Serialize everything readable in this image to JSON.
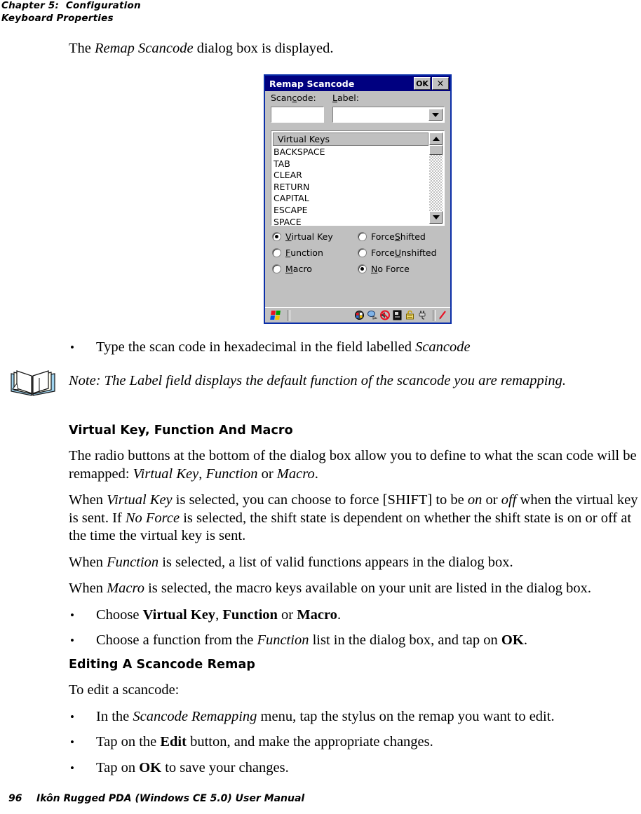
{
  "header": {
    "chapter": "Chapter 5:  Configuration",
    "section": "Keyboard Properties"
  },
  "intro": {
    "line_before": "The ",
    "emphasis": "Remap Scancode",
    "line_after": " dialog box is displayed."
  },
  "dialog": {
    "title": "Remap Scancode",
    "ok_label": "OK",
    "close_label": "×",
    "scancode_label": {
      "pre": "Scan",
      "accel": "c",
      "post": "ode:"
    },
    "label_label": {
      "pre": "",
      "accel": "L",
      "post": "abel:"
    },
    "scancode_value": "",
    "label_value": "",
    "list_header": "Virtual Keys",
    "list_items": [
      "BACKSPACE",
      "TAB",
      "CLEAR",
      "RETURN",
      "CAPITAL",
      "ESCAPE",
      "SPACE"
    ],
    "radios_left": [
      {
        "pre": "",
        "accel": "V",
        "post": "irtual Key",
        "selected": true
      },
      {
        "pre": "",
        "accel": "F",
        "post": "unction",
        "selected": false
      },
      {
        "pre": "",
        "accel": "M",
        "post": "acro",
        "selected": false
      }
    ],
    "radios_right": [
      {
        "pre": "Force ",
        "accel": "S",
        "post": "hifted",
        "selected": false
      },
      {
        "pre": "Force ",
        "accel": "U",
        "post": "nshifted",
        "selected": false
      },
      {
        "pre": "",
        "accel": "N",
        "post": "o Force",
        "selected": true
      }
    ],
    "titlebar_color": "#000080",
    "face_color": "#c0c0c0",
    "border_color": "#0a2ea8",
    "taskbar": {
      "start_icon": "windows-flag-icon",
      "tray_icons": [
        "network-icon",
        "desktop-icon",
        "no-sound-icon",
        "battery-icon",
        "unlock-icon",
        "power-plug-icon",
        "stylus-icon"
      ]
    }
  },
  "bullet_type_scan": {
    "pre": "Type the scan code in hexadecimal in the field labelled ",
    "em": "Scancode",
    "post": ""
  },
  "note": {
    "icon": "open-book-icon",
    "text": "Note: The Label field displays the default function of the scancode you are remapping."
  },
  "section_vkfm": {
    "heading": "Virtual Key, Function And Macro",
    "para1": {
      "a": "The radio buttons at the bottom of the dialog box allow you to define to what the scan code will be remapped: ",
      "em1": "Virtual Key",
      "b": ", ",
      "em2": "Function",
      "c": " or ",
      "em3": "Macro",
      "d": "."
    },
    "para2": {
      "a": "When ",
      "em1": "Virtual Key",
      "b": " is selected, you can choose to force [SHIFT] to be ",
      "em2": "on",
      "c": " or ",
      "em3": "off",
      "d": " when the virtual key is sent. If ",
      "em4": "No Force",
      "e": " is selected, the shift state is dependent on whether the shift state is on or off at the time the virtual key is sent."
    },
    "para3": {
      "a": "When ",
      "em1": "Function",
      "b": " is selected, a list of valid functions appears in the dialog box."
    },
    "para4": {
      "a": "When ",
      "em1": "Macro",
      "b": " is selected, the macro keys available on your unit are listed in the dialog box."
    },
    "bullet1": {
      "a": "Choose ",
      "b1": "Virtual Key",
      "c": ", ",
      "b2": "Function",
      "d": " or ",
      "b3": "Macro",
      "e": "."
    },
    "bullet2": {
      "a": "Choose a function from the ",
      "em": "Function",
      "b": " list in the dialog box, and tap on ",
      "bd": "OK",
      "c": "."
    }
  },
  "section_edit": {
    "heading": "Editing A Scancode Remap",
    "lead": "To edit a scancode:",
    "bullet1": {
      "a": "In the ",
      "em": "Scancode Remapping",
      "b": " menu, tap the stylus on the remap you want to edit."
    },
    "bullet2": {
      "a": "Tap on the ",
      "bd": "Edit",
      "b": " button, and make the appropriate changes."
    },
    "bullet3": {
      "a": "Tap on ",
      "bd": "OK",
      "b": " to save your changes."
    }
  },
  "footer": {
    "page_number": "96",
    "manual_title": "Ikôn Rugged PDA (Windows CE 5.0) User Manual"
  }
}
